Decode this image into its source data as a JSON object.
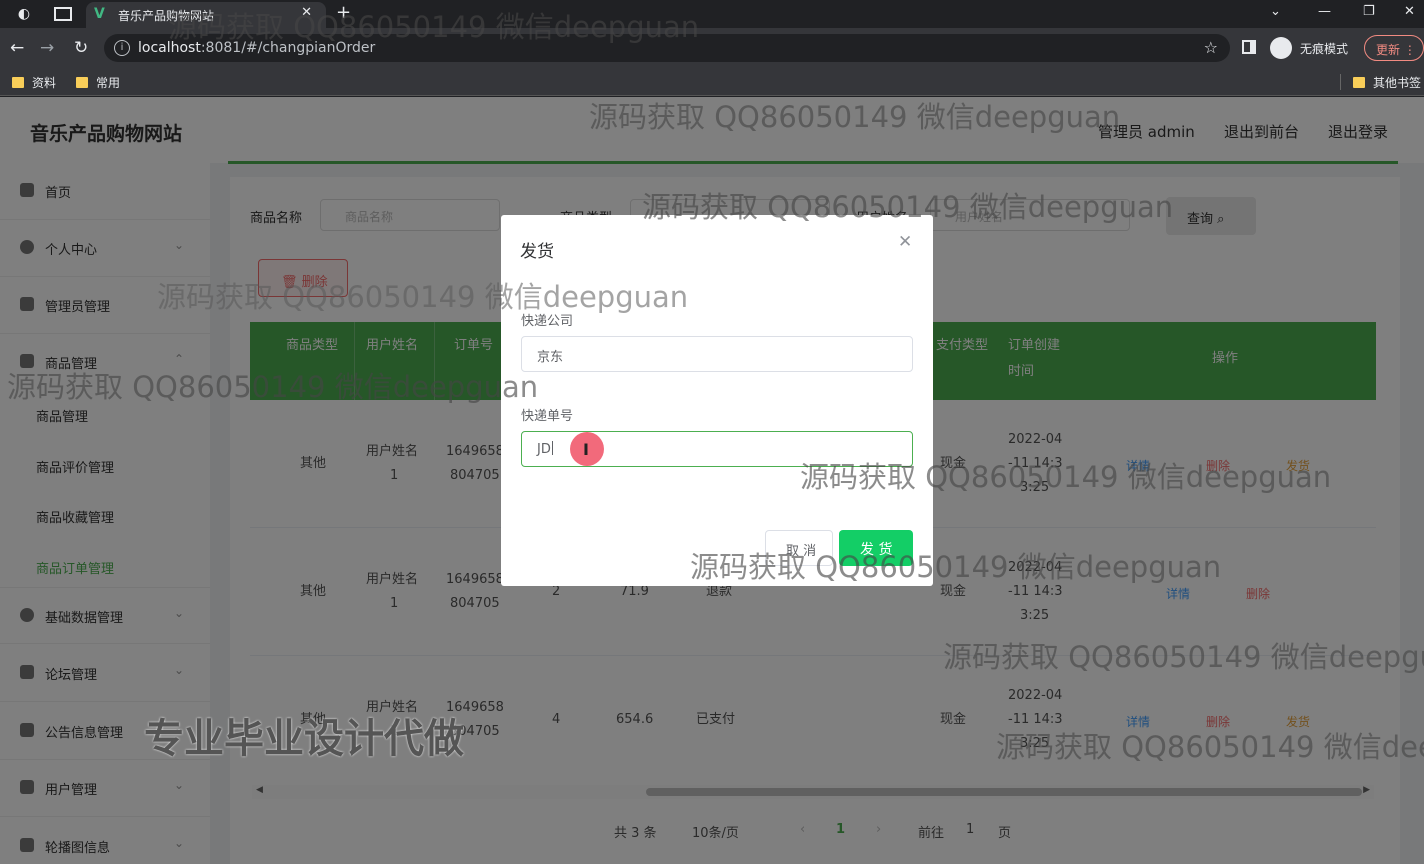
{
  "browser": {
    "tab_title": "音乐产品购物网站",
    "tab_favicon": "vue-logo-icon",
    "url_host": "localhost",
    "url_rest": ":8081/#/changpianOrder",
    "incognito_label": "无痕模式",
    "update_label": "更新",
    "bookmarks": [
      "资料",
      "常用"
    ],
    "bookmarks_other": "其他书签"
  },
  "site": {
    "title": "音乐产品购物网站",
    "admin_label": "管理员 admin",
    "to_front_label": "退出到前台",
    "logout_label": "退出登录"
  },
  "sidebar": {
    "items": [
      {
        "label": "首页",
        "icon": "home-icon"
      },
      {
        "label": "个人中心",
        "icon": "user-icon"
      },
      {
        "label": "管理员管理",
        "icon": "admin-icon"
      },
      {
        "label": "商品管理",
        "icon": "product-icon"
      },
      {
        "label": "基础数据管理",
        "icon": "data-icon"
      },
      {
        "label": "论坛管理",
        "icon": "forum-icon"
      },
      {
        "label": "公告信息管理",
        "icon": "notice-icon"
      },
      {
        "label": "用户管理",
        "icon": "users-icon"
      },
      {
        "label": "轮播图信息",
        "icon": "carousel-icon"
      }
    ],
    "subitems": [
      "商品管理",
      "商品评价管理",
      "商品收藏管理",
      "商品订单管理"
    ],
    "active_subitem": "商品订单管理"
  },
  "filters": {
    "name_label": "商品名称",
    "name_placeholder": "商品名称",
    "type_label": "商品类型",
    "user_label": "用户姓名",
    "user_placeholder": "用户姓名",
    "query_label": "查询"
  },
  "toolbar": {
    "delete_label": "删除"
  },
  "table": {
    "headers": [
      "商品类型",
      "用户姓名",
      "订单号",
      "支付类型",
      "订单创建",
      "时间",
      "操作"
    ],
    "rows": [
      {
        "type": "其他",
        "user": [
          "用户姓名",
          "1"
        ],
        "order_no": [
          "1649658",
          "804705"
        ],
        "pay_type": "现金",
        "created": [
          "2022-04",
          "-11 14:3",
          "3:25"
        ],
        "ops": [
          "详情",
          "删除",
          "发货"
        ]
      },
      {
        "type": "其他",
        "user": [
          "用户姓名",
          "1"
        ],
        "order_no": [
          "1649658",
          "804705"
        ],
        "qty": "2",
        "price": "71.9",
        "status": "退款",
        "pay_type": "现金",
        "created": [
          "2022-04",
          "-11 14:3",
          "3:25"
        ],
        "ops": [
          "详情",
          "删除"
        ]
      },
      {
        "type": "其他",
        "user": [
          "用户姓名",
          "1"
        ],
        "order_no": [
          "1649658",
          "804705"
        ],
        "qty": "4",
        "price": "654.6",
        "status": "已支付",
        "pay_type": "现金",
        "created": [
          "2022-04",
          "-11 14:3",
          "3:25"
        ],
        "ops": [
          "详情",
          "删除",
          "发货"
        ]
      }
    ]
  },
  "pagination": {
    "total": "共 3 条",
    "page_size": "10条/页",
    "current": "1",
    "goto_label": "前往",
    "goto_value": "1",
    "page_suffix": "页"
  },
  "dialog": {
    "title": "发货",
    "company_label": "快递公司",
    "company_value": "京东",
    "tracking_label": "快递单号",
    "tracking_value": "JD",
    "cancel_label": "取 消",
    "confirm_label": "发 货"
  },
  "watermark": "源码获取 QQ86050149 微信deepguan",
  "ad_text": "专业毕业设计代做"
}
